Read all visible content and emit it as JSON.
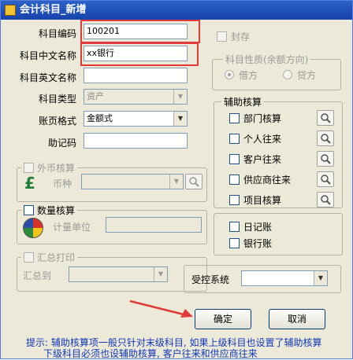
{
  "window": {
    "title": "会计科目_新增"
  },
  "form": {
    "code_label": "科目编码",
    "code_value": "100201",
    "cn_name_label": "科目中文名称",
    "cn_name_value": "xx银行",
    "en_name_label": "科目英文名称",
    "en_name_value": "",
    "type_label": "科目类型",
    "type_value": "资产",
    "format_label": "账页格式",
    "format_value": "金额式",
    "memo_label": "助记码",
    "memo_value": ""
  },
  "seal": {
    "label": "封存"
  },
  "nature": {
    "group_label": "科目性质(余额方向)",
    "debit_label": "借方",
    "credit_label": "贷方"
  },
  "aux": {
    "group_label": "辅助核算",
    "items": [
      {
        "label": "部门核算"
      },
      {
        "label": "个人往来"
      },
      {
        "label": "客户往来"
      },
      {
        "label": "供应商往来"
      },
      {
        "label": "项目核算"
      }
    ]
  },
  "foreign": {
    "label": "外币核算",
    "currency_label": "币种"
  },
  "quantity": {
    "label": "数量核算",
    "unit_label": "计量单位"
  },
  "summary": {
    "label": "汇总打印",
    "to_label": "汇总到"
  },
  "journals": {
    "daily_label": "日记账",
    "bank_label": "银行账"
  },
  "controlled": {
    "label": "受控系统"
  },
  "buttons": {
    "ok_label": "确定",
    "cancel_label": "取消"
  },
  "hint": {
    "line1": "提示: 辅助核算项一般只针对末级科目, 如果上级科目也设置了辅助核算",
    "line2": "下级科目必须也设辅助核算, 客户往来和供应商往来"
  },
  "colors": {
    "title_bar": "#1743ad",
    "highlight_box": "#e23a3a",
    "hint_text": "#1038b8"
  }
}
